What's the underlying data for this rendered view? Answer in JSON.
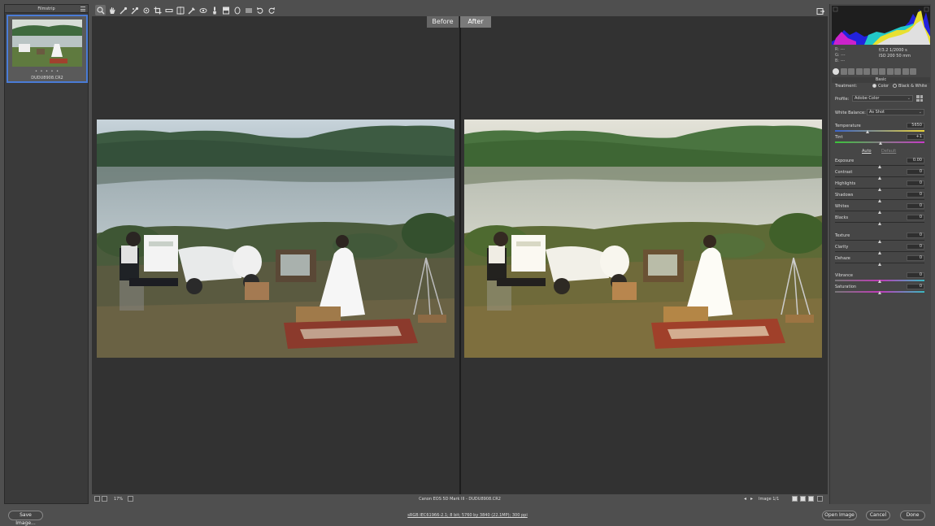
{
  "filmstrip": {
    "title": "Filmstrip",
    "stars": "• • • • •",
    "filename": "DUDU8908.CR2"
  },
  "toolbar": {
    "tools": [
      "zoom-icon",
      "hand-icon",
      "white-balance-icon",
      "color-sampler-icon",
      "targeted-adjust-icon",
      "crop-icon",
      "straighten-icon",
      "transform-icon",
      "spot-removal-icon",
      "red-eye-icon",
      "adjustment-brush-icon",
      "graduated-filter-icon",
      "radial-filter-icon",
      "preferences-icon",
      "rotate-left-icon",
      "rotate-right-icon"
    ],
    "active_tool": "zoom-icon"
  },
  "viewer": {
    "before_label": "Before",
    "after_label": "After"
  },
  "status": {
    "zoom": "17%",
    "camera": "Canon EOS 5D Mark III  -  DUDU8908.CR2",
    "image_count": "Image 1/1"
  },
  "histogram": {
    "rgb": {
      "r": "R:  ---",
      "g": "G:  ---",
      "b": "B:  ---"
    },
    "aperture_shutter": "f/3.2    1/2000 s",
    "iso_focal": "ISO 200    50 mm"
  },
  "panel": {
    "section": "Basic",
    "treatment_label": "Treatment:",
    "treatment_color": "Color",
    "treatment_bw": "Black & White",
    "treatment_selected": "Color",
    "profile_label": "Profile:",
    "profile_value": "Adobe Color",
    "wb_label": "White Balance:",
    "wb_value": "As Shot",
    "auto_label": "Auto",
    "default_label": "Default",
    "sliders": [
      {
        "label": "Temperature",
        "value": "5650",
        "pos": 0.36
      },
      {
        "label": "Tint",
        "value": "+1",
        "pos": 0.51
      },
      {
        "label": "Exposure",
        "value": "0.00",
        "pos": 0.5
      },
      {
        "label": "Contrast",
        "value": "0",
        "pos": 0.5
      },
      {
        "label": "Highlights",
        "value": "0",
        "pos": 0.5
      },
      {
        "label": "Shadows",
        "value": "0",
        "pos": 0.5
      },
      {
        "label": "Whites",
        "value": "0",
        "pos": 0.5
      },
      {
        "label": "Blacks",
        "value": "0",
        "pos": 0.5
      },
      {
        "label": "Texture",
        "value": "0",
        "pos": 0.5
      },
      {
        "label": "Clarity",
        "value": "0",
        "pos": 0.5
      },
      {
        "label": "Dehaze",
        "value": "0",
        "pos": 0.5
      },
      {
        "label": "Vibrance",
        "value": "0",
        "pos": 0.5
      },
      {
        "label": "Saturation",
        "value": "0",
        "pos": 0.5
      }
    ]
  },
  "bottom": {
    "save_label": "Save Image...",
    "workflow": "sRGB IEC61966-2.1; 8 bit; 5760 by 3840 (22.1MP); 300 ppi",
    "open_label": "Open Image",
    "cancel_label": "Cancel",
    "done_label": "Done"
  }
}
